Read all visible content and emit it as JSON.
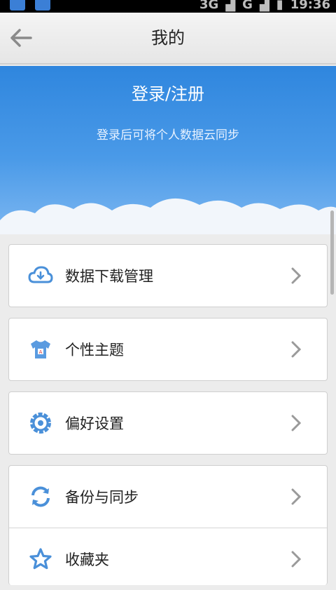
{
  "status_bar": {
    "network": "3G",
    "network2": "G",
    "time": "19:36"
  },
  "header": {
    "title": "我的",
    "back_icon": "back-arrow-icon"
  },
  "hero": {
    "login_label": "登录/注册",
    "subtitle": "登录后可将个人数据云同步"
  },
  "menu": {
    "items": [
      {
        "label": "数据下载管理",
        "icon": "cloud-download-icon"
      },
      {
        "label": "个性主题",
        "icon": "tshirt-icon"
      },
      {
        "label": "偏好设置",
        "icon": "gear-icon"
      },
      {
        "label": "备份与同步",
        "icon": "sync-icon"
      },
      {
        "label": "收藏夹",
        "icon": "star-icon"
      }
    ]
  },
  "colors": {
    "accent": "#2f86de",
    "icon": "#4a90d9"
  }
}
